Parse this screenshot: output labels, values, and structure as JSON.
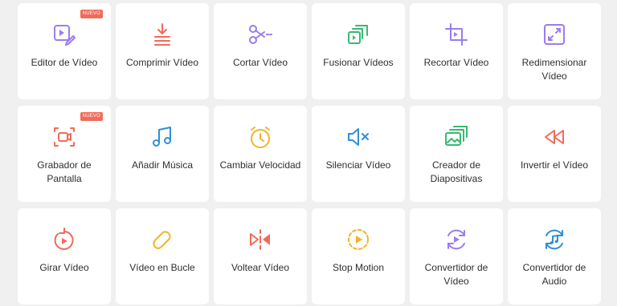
{
  "badge_text": "NUEVO",
  "tools": [
    {
      "label": "Editor de Vídeo",
      "icon": "video-edit-icon",
      "color": "#9b7cf0",
      "badge": true
    },
    {
      "label": "Comprimir Vídeo",
      "icon": "compress-icon",
      "color": "#f06b5a",
      "badge": false
    },
    {
      "label": "Cortar Vídeo",
      "icon": "scissors-icon",
      "color": "#9b7cf0",
      "badge": false
    },
    {
      "label": "Fusionar Vídeos",
      "icon": "merge-icon",
      "color": "#3ab872",
      "badge": false
    },
    {
      "label": "Recortar Vídeo",
      "icon": "crop-icon",
      "color": "#9b7cf0",
      "badge": false
    },
    {
      "label": "Redimensionar\nVídeo",
      "icon": "resize-icon",
      "color": "#9b7cf0",
      "badge": false
    },
    {
      "label": "Grabador de\nPantalla",
      "icon": "screen-record-icon",
      "color": "#f06b5a",
      "badge": true
    },
    {
      "label": "Añadir Música",
      "icon": "music-icon",
      "color": "#2f8fd6",
      "badge": false
    },
    {
      "label": "Cambiar Velocidad",
      "icon": "stopwatch-icon",
      "color": "#f0b429",
      "badge": false
    },
    {
      "label": "Silenciar Vídeo",
      "icon": "mute-icon",
      "color": "#2f8fd6",
      "badge": false
    },
    {
      "label": "Creador de\nDiapositivas",
      "icon": "slideshow-icon",
      "color": "#3ab872",
      "badge": false
    },
    {
      "label": "Invertir el Vídeo",
      "icon": "rewind-icon",
      "color": "#f06b5a",
      "badge": false
    },
    {
      "label": "Girar Vídeo",
      "icon": "rotate-icon",
      "color": "#f06b5a",
      "badge": false
    },
    {
      "label": "Vídeo en Bucle",
      "icon": "loop-icon",
      "color": "#f0b429",
      "badge": false
    },
    {
      "label": "Voltear Vídeo",
      "icon": "flip-icon",
      "color": "#f06b5a",
      "badge": false
    },
    {
      "label": "Stop Motion",
      "icon": "stop-motion-icon",
      "color": "#f0b429",
      "badge": false
    },
    {
      "label": "Convertidor de\nVídeo",
      "icon": "video-convert-icon",
      "color": "#9b7cf0",
      "badge": false
    },
    {
      "label": "Convertidor de\nAudio",
      "icon": "audio-convert-icon",
      "color": "#2f8fd6",
      "badge": false
    }
  ]
}
